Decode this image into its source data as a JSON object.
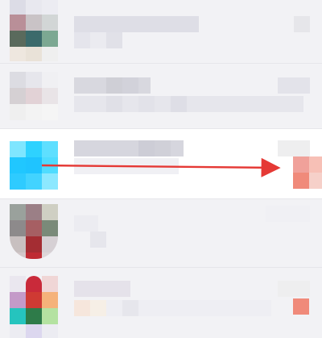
{
  "app": {
    "screen": "conversation-list"
  },
  "conversations": [
    {
      "name": "",
      "preview": "",
      "time": "",
      "has_unread_badge": false
    },
    {
      "name": "",
      "preview": "",
      "time": "",
      "has_unread_badge": false
    },
    {
      "name": "",
      "preview": "",
      "time": "",
      "has_unread_badge": true
    },
    {
      "name": "",
      "preview": "",
      "time": "",
      "has_unread_badge": false
    },
    {
      "name": "",
      "preview": "",
      "time": "",
      "has_unread_badge": true
    }
  ],
  "annotation": {
    "type": "arrow",
    "color": "#e53935",
    "direction": "right",
    "points_to": "unread-badge"
  },
  "colors": {
    "list_background": "#f4f4f6",
    "row_highlight": "#ffffff",
    "badge": "#f08a7a",
    "accent_avatar": "#2ecbff"
  }
}
